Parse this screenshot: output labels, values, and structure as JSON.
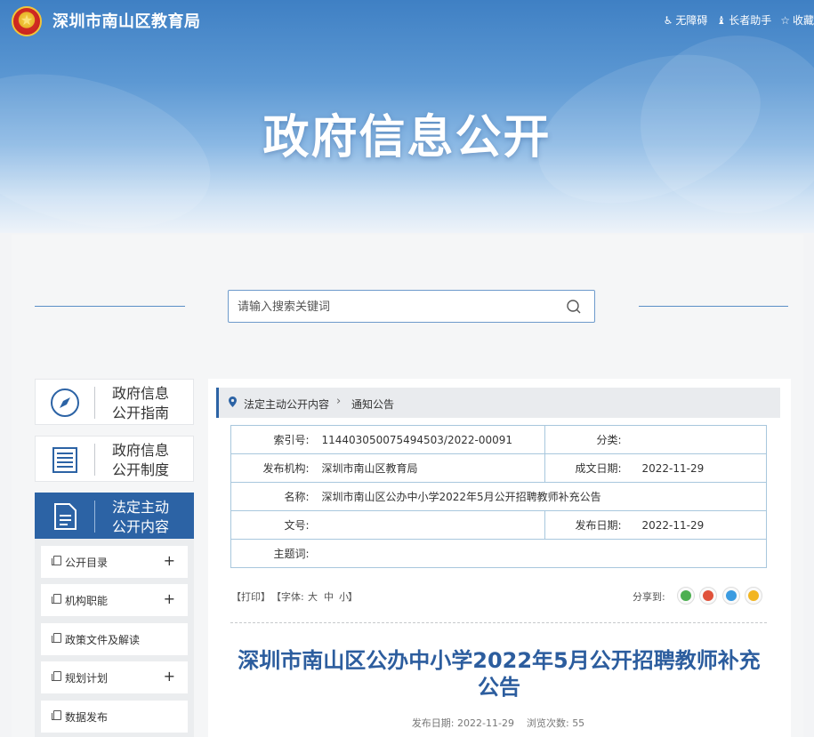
{
  "header": {
    "site_name": "深圳市南山区教育局",
    "tools": [
      {
        "icon": "accessibility-icon",
        "label": "无障碍"
      },
      {
        "icon": "elderly-helper-icon",
        "label": "长者助手"
      },
      {
        "icon": "star-icon",
        "label": "收藏"
      }
    ],
    "banner_title": "政府信息公开"
  },
  "search": {
    "placeholder": "请输入搜索关键词"
  },
  "sidebar": {
    "cards": [
      {
        "line1": "政府信息",
        "line2": "公开指南",
        "icon": "compass-icon",
        "active": false
      },
      {
        "line1": "政府信息",
        "line2": "公开制度",
        "icon": "list-document-icon",
        "active": false
      },
      {
        "line1": "法定主动",
        "line2": "公开内容",
        "icon": "document-icon",
        "active": true
      }
    ],
    "sub_items": [
      {
        "label": "公开目录",
        "expandable": "+"
      },
      {
        "label": "机构职能",
        "expandable": "+"
      },
      {
        "label": "政策文件及解读",
        "expandable": ""
      },
      {
        "label": "规划计划",
        "expandable": "+"
      },
      {
        "label": "数据发布",
        "expandable": ""
      }
    ]
  },
  "breadcrumb": {
    "items": [
      "法定主动公开内容",
      "通知公告"
    ],
    "separator": "›"
  },
  "meta": {
    "index_label": "索引号:",
    "index_value": "114403050075494503/2022-00091",
    "category_label": "分类:",
    "category_value": "",
    "issuer_label": "发布机构:",
    "issuer_value": "深圳市南山区教育局",
    "created_label": "成文日期:",
    "created_value": "2022-11-29",
    "name_label": "名称:",
    "name_value": "深圳市南山区公办中小学2022年5月公开招聘教师补充公告",
    "docno_label": "文号:",
    "docno_value": "",
    "published_label": "发布日期:",
    "published_value": "2022-11-29",
    "keywords_label": "主题词:",
    "keywords_value": ""
  },
  "toolbar": {
    "print": "【打印】",
    "font_prefix": "【字体:",
    "font_large": "大",
    "font_medium": "中",
    "font_small": "小",
    "font_suffix": "】",
    "share_label": "分享到:",
    "share_targets": [
      "wechat-icon",
      "weibo-icon",
      "qq-icon",
      "qzone-icon"
    ],
    "share_colors": [
      "#4caf50",
      "#e0523b",
      "#3b9be0",
      "#f2b521"
    ]
  },
  "article": {
    "title": "深圳市南山区公办中小学2022年5月公开招聘教师补充公告",
    "publish_label": "发布日期:",
    "publish_date": "2022-11-29",
    "views_label": "浏览次数:",
    "views": "55"
  }
}
